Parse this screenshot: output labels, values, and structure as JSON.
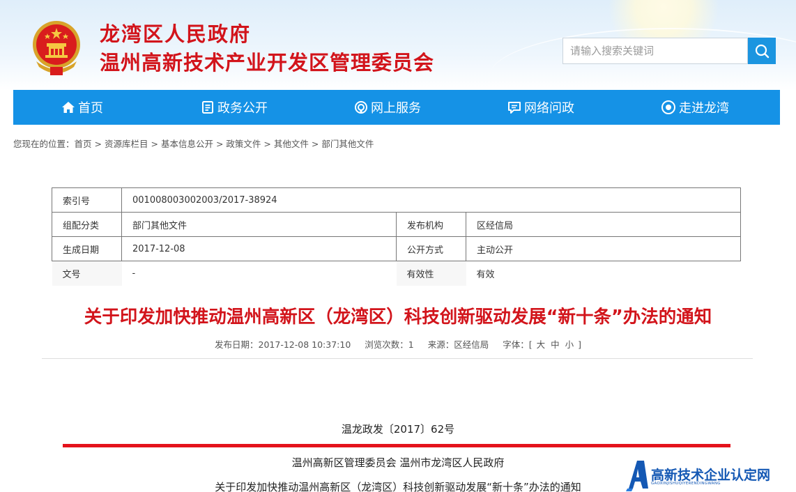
{
  "header": {
    "site_name_line1": "龙湾区人民政府",
    "site_name_line2": "温州高新技术产业开发区管理委员会",
    "search_placeholder": "请输入搜索关键词"
  },
  "nav": {
    "items": [
      {
        "label": "首页",
        "icon": "home-icon"
      },
      {
        "label": "政务公开",
        "icon": "document-icon"
      },
      {
        "label": "网上服务",
        "icon": "service-icon"
      },
      {
        "label": "网络问政",
        "icon": "chat-icon"
      },
      {
        "label": "走进龙湾",
        "icon": "eye-icon"
      }
    ]
  },
  "breadcrumb": {
    "prefix": "您现在的位置：",
    "items": [
      "首页",
      "资源库栏目",
      "基本信息公开",
      "政策文件",
      "其他文件",
      "部门其他文件"
    ],
    "separator": ">"
  },
  "meta": {
    "index_label": "索引号",
    "index_value": "001008003002003/2017-38924",
    "category_label": "组配分类",
    "category_value": "部门其他文件",
    "publisher_label": "发布机构",
    "publisher_value": "区经信局",
    "date_label": "生成日期",
    "date_value": "2017-12-08",
    "disclosure_label": "公开方式",
    "disclosure_value": "主动公开",
    "docno_label": "文号",
    "docno_value": "-",
    "validity_label": "有效性",
    "validity_value": "有效"
  },
  "article": {
    "title": "关于印发加快推动温州高新区（龙湾区）科技创新驱动发展“新十条”办法的通知",
    "publish_date": "发布日期：2017-12-08 10:37:10",
    "views": "浏览次数：1",
    "source": "来源：区经信局",
    "font_size_label": "字体：[",
    "font_large": "大",
    "font_medium": "中",
    "font_small": "小",
    "font_size_end": "]",
    "doc_number": "温龙政发〔2017〕62号",
    "issuers": "温州高新区管理委员会 温州市龙湾区人民政府",
    "subtitle": "关于印发加快推动温州高新区（龙湾区）科技创新驱动发展“新十条”办法的通知"
  },
  "watermark": {
    "text": "高新技术企业认定网",
    "sub": "GAOXINJISHUQIYERENDINGWANG"
  },
  "colors": {
    "brand_red": "#d2141b",
    "nav_blue": "#1592e6",
    "search_blue": "#1b95e0",
    "rule_red": "#e4121b",
    "watermark_blue": "#1458b4"
  }
}
